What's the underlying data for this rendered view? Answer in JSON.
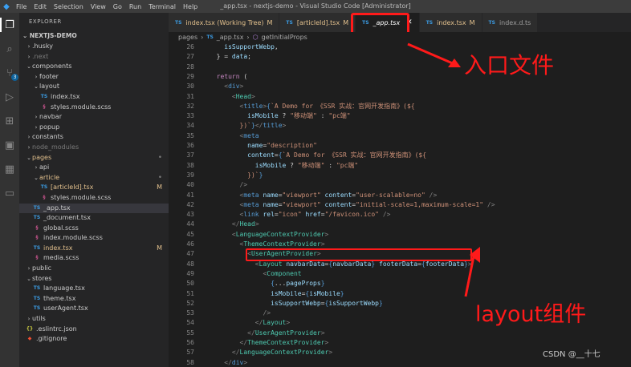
{
  "titlebar": {
    "menu": [
      "File",
      "Edit",
      "Selection",
      "View",
      "Go",
      "Run",
      "Terminal",
      "Help"
    ],
    "window_title": "_app.tsx - nextjs-demo - Visual Studio Code [Administrator]"
  },
  "activity_bar": {
    "icons": [
      "explorer-icon",
      "search-icon",
      "source-control-icon",
      "run-debug-icon",
      "extensions-icon",
      "remote-explorer-icon",
      "grid-icon",
      "monitor-icon"
    ],
    "scm_badge": "3"
  },
  "sidebar": {
    "header": "EXPLORER",
    "project": "NEXTJS-DEMO",
    "items": [
      {
        "label": ".husky",
        "type": "folder",
        "open": false,
        "depth": 0,
        "style": "normal"
      },
      {
        "label": ".next",
        "type": "folder",
        "open": false,
        "depth": 0,
        "style": "dim"
      },
      {
        "label": "components",
        "type": "folder",
        "open": true,
        "depth": 0,
        "style": "normal"
      },
      {
        "label": "footer",
        "type": "folder",
        "open": false,
        "depth": 1,
        "style": "normal"
      },
      {
        "label": "layout",
        "type": "folder",
        "open": true,
        "depth": 1,
        "style": "normal"
      },
      {
        "label": "index.tsx",
        "type": "ts",
        "depth": 2,
        "style": "normal"
      },
      {
        "label": "styles.module.scss",
        "type": "scss",
        "depth": 2,
        "style": "normal"
      },
      {
        "label": "navbar",
        "type": "folder",
        "open": false,
        "depth": 1,
        "style": "normal"
      },
      {
        "label": "popup",
        "type": "folder",
        "open": false,
        "depth": 1,
        "style": "normal"
      },
      {
        "label": "constants",
        "type": "folder",
        "open": false,
        "depth": 0,
        "style": "normal"
      },
      {
        "label": "node_modules",
        "type": "folder",
        "open": false,
        "depth": 0,
        "style": "dim"
      },
      {
        "label": "pages",
        "type": "folder",
        "open": true,
        "depth": 0,
        "style": "mod",
        "mark": "•"
      },
      {
        "label": "api",
        "type": "folder",
        "open": false,
        "depth": 1,
        "style": "normal"
      },
      {
        "label": "article",
        "type": "folder",
        "open": true,
        "depth": 1,
        "style": "mod",
        "mark": "•"
      },
      {
        "label": "[articleId].tsx",
        "type": "ts",
        "depth": 2,
        "style": "mod",
        "mark": "M"
      },
      {
        "label": "styles.module.scss",
        "type": "scss",
        "depth": 2,
        "style": "normal"
      },
      {
        "label": "_app.tsx",
        "type": "ts",
        "depth": 1,
        "style": "normal",
        "selected": true
      },
      {
        "label": "_document.tsx",
        "type": "ts",
        "depth": 1,
        "style": "normal"
      },
      {
        "label": "global.scss",
        "type": "scss",
        "depth": 1,
        "style": "normal"
      },
      {
        "label": "index.module.scss",
        "type": "scss",
        "depth": 1,
        "style": "normal"
      },
      {
        "label": "index.tsx",
        "type": "ts",
        "depth": 1,
        "style": "mod",
        "mark": "M"
      },
      {
        "label": "media.scss",
        "type": "scss",
        "depth": 1,
        "style": "normal"
      },
      {
        "label": "public",
        "type": "folder",
        "open": false,
        "depth": 0,
        "style": "normal"
      },
      {
        "label": "stores",
        "type": "folder",
        "open": true,
        "depth": 0,
        "style": "normal"
      },
      {
        "label": "language.tsx",
        "type": "ts",
        "depth": 1,
        "style": "normal"
      },
      {
        "label": "theme.tsx",
        "type": "ts",
        "depth": 1,
        "style": "normal"
      },
      {
        "label": "userAgent.tsx",
        "type": "ts",
        "depth": 1,
        "style": "normal"
      },
      {
        "label": "utils",
        "type": "folder",
        "open": false,
        "depth": 0,
        "style": "normal"
      },
      {
        "label": ".eslintrc.json",
        "type": "json",
        "depth": 0,
        "style": "normal"
      },
      {
        "label": ".gitignore",
        "type": "git",
        "depth": 0,
        "style": "normal"
      }
    ]
  },
  "tabs": [
    {
      "label": "index.tsx (Working Tree)",
      "mark": "M",
      "active": false,
      "style": "mod"
    },
    {
      "label": "[articleId].tsx",
      "mark": "M",
      "active": false,
      "style": "mod"
    },
    {
      "label": "_app.tsx",
      "mark": "",
      "active": true,
      "style": "active"
    },
    {
      "label": "index.tsx",
      "mark": "M",
      "active": false,
      "style": "mod"
    },
    {
      "label": "index.d.ts",
      "mark": "",
      "active": false,
      "style": "plain"
    }
  ],
  "breadcrumbs": {
    "folder": "pages",
    "file": "_app.tsx",
    "symbol": "getInitialProps"
  },
  "code_lines": [
    {
      "n": "26",
      "html": "    <span class='v'>isSupportWebp</span><span class='p'>,</span>"
    },
    {
      "n": "27",
      "html": "  <span class='p'>} = </span><span class='v'>data</span><span class='p'>;</span>"
    },
    {
      "n": "28",
      "html": ""
    },
    {
      "n": "29",
      "html": "  <span class='k'>return</span> <span class='p'>(</span>"
    },
    {
      "n": "30",
      "html": "    <span class='gy'>&lt;</span><span class='tg'>div</span><span class='gy'>&gt;</span>"
    },
    {
      "n": "31",
      "html": "      <span class='gy'>&lt;</span><span class='t'>Head</span><span class='gy'>&gt;</span>"
    },
    {
      "n": "32",
      "html": "        <span class='gy'>&lt;</span><span class='tg'>title</span><span class='gy'>&gt;</span><span class='tg'>{</span><span class='s'>`A Demo for 《SSR 实战：官网开发指南》(${</span>"
    },
    {
      "n": "33",
      "html": "          <span class='v'>isMobile</span> <span class='p'>?</span> <span class='s'>\"移动端\"</span> <span class='p'>:</span> <span class='s'>\"pc端\"</span>"
    },
    {
      "n": "34",
      "html": "        <span class='s'>})`</span><span class='tg'>}</span><span class='gy'>&lt;/</span><span class='tg'>title</span><span class='gy'>&gt;</span>"
    },
    {
      "n": "35",
      "html": "        <span class='gy'>&lt;</span><span class='tg'>meta</span>"
    },
    {
      "n": "36",
      "html": "          <span class='a'>name</span><span class='p'>=</span><span class='s'>\"description\"</span>"
    },
    {
      "n": "37",
      "html": "          <span class='a'>content</span><span class='p'>=</span><span class='tg'>{</span><span class='s'>`A Demo for 《SSR 实战：官网开发指南》(${</span>"
    },
    {
      "n": "38",
      "html": "            <span class='v'>isMobile</span> <span class='p'>?</span> <span class='s'>\"移动端\"</span> <span class='p'>:</span> <span class='s'>\"pc端\"</span>"
    },
    {
      "n": "39",
      "html": "          <span class='s'>})`</span><span class='tg'>}</span>"
    },
    {
      "n": "40",
      "html": "        <span class='gy'>/&gt;</span>"
    },
    {
      "n": "41",
      "html": "        <span class='gy'>&lt;</span><span class='tg'>meta</span> <span class='a'>name</span><span class='p'>=</span><span class='s'>\"viewport\"</span> <span class='a'>content</span><span class='p'>=</span><span class='s'>\"user-scalable=no\"</span> <span class='gy'>/&gt;</span>"
    },
    {
      "n": "42",
      "html": "        <span class='gy'>&lt;</span><span class='tg'>meta</span> <span class='a'>name</span><span class='p'>=</span><span class='s'>\"viewport\"</span> <span class='a'>content</span><span class='p'>=</span><span class='s'>\"initial-scale=1,maximum-scale=1\"</span> <span class='gy'>/&gt;</span>"
    },
    {
      "n": "43",
      "html": "        <span class='gy'>&lt;</span><span class='tg'>link</span> <span class='a'>rel</span><span class='p'>=</span><span class='s'>\"icon\"</span> <span class='a'>href</span><span class='p'>=</span><span class='s'>\"/favicon.ico\"</span> <span class='gy'>/&gt;</span>"
    },
    {
      "n": "44",
      "html": "      <span class='gy'>&lt;/</span><span class='t'>Head</span><span class='gy'>&gt;</span>"
    },
    {
      "n": "45",
      "html": "      <span class='gy'>&lt;</span><span class='t'>LanguageContextProvider</span><span class='gy'>&gt;</span>"
    },
    {
      "n": "46",
      "html": "        <span class='gy'>&lt;</span><span class='t'>ThemeContextProvider</span><span class='gy'>&gt;</span>"
    },
    {
      "n": "47",
      "html": "          <span class='gy'>&lt;</span><span class='t'>UserAgentProvider</span><span class='gy'>&gt;</span>"
    },
    {
      "n": "48",
      "html": "            <span class='gy'>&lt;</span><span class='t'>Layout</span> <span class='a'>navbarData</span><span class='p'>=</span><span class='tg'>{</span><span class='v'>navbarData</span><span class='tg'>}</span> <span class='a'>footerData</span><span class='p'>=</span><span class='tg'>{</span><span class='v'>footerData</span><span class='tg'>}</span><span class='gy'>&gt;</span>"
    },
    {
      "n": "49",
      "html": "              <span class='gy'>&lt;</span><span class='t'>Component</span>"
    },
    {
      "n": "50",
      "html": "                <span class='tg'>{</span><span class='p'>...</span><span class='v'>pageProps</span><span class='tg'>}</span>"
    },
    {
      "n": "51",
      "html": "                <span class='a'>isMobile</span><span class='p'>=</span><span class='tg'>{</span><span class='v'>isMobile</span><span class='tg'>}</span>"
    },
    {
      "n": "52",
      "html": "                <span class='a'>isSupportWebp</span><span class='p'>=</span><span class='tg'>{</span><span class='v'>isSupportWebp</span><span class='tg'>}</span>"
    },
    {
      "n": "53",
      "html": "              <span class='gy'>/&gt;</span>"
    },
    {
      "n": "54",
      "html": "            <span class='gy'>&lt;/</span><span class='t'>Layout</span><span class='gy'>&gt;</span>"
    },
    {
      "n": "55",
      "html": "          <span class='gy'>&lt;/</span><span class='t'>UserAgentProvider</span><span class='gy'>&gt;</span>"
    },
    {
      "n": "56",
      "html": "        <span class='gy'>&lt;/</span><span class='t'>ThemeContextProvider</span><span class='gy'>&gt;</span>"
    },
    {
      "n": "57",
      "html": "      <span class='gy'>&lt;/</span><span class='t'>LanguageContextProvider</span><span class='gy'>&gt;</span>"
    },
    {
      "n": "58",
      "html": "    <span class='gy'>&lt;/</span><span class='tg'>div</span><span class='gy'>&gt;</span>"
    },
    {
      "n": "59",
      "html": "  <span class='p'>);</span>"
    }
  ],
  "annotations": {
    "entry_label": "入口文件",
    "layout_label": "layout组件",
    "accent_color": "#ff1a1a"
  },
  "credit": "CSDN @__十七",
  "colors": {
    "editor_bg": "#1e1e1e",
    "sidebar_bg": "#252526",
    "activity_bg": "#333333",
    "titlebar_bg": "#3c3c3c",
    "modified": "#e2c08d",
    "ts_icon": "#3b9ae1",
    "scss_icon": "#c6538c"
  }
}
